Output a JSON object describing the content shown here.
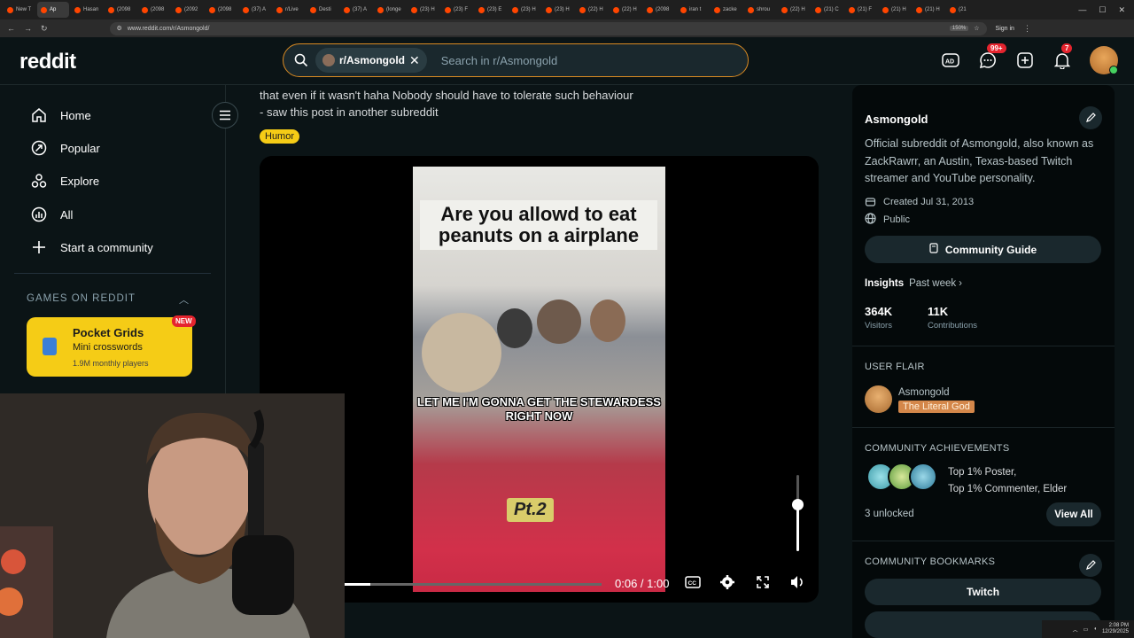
{
  "browser": {
    "tabs": [
      {
        "label": "New T"
      },
      {
        "label": "Ap",
        "active": true
      },
      {
        "label": "Hasan"
      },
      {
        "label": "(2098"
      },
      {
        "label": "(2098"
      },
      {
        "label": "(2092"
      },
      {
        "label": "(2098"
      },
      {
        "label": "(37) A"
      },
      {
        "label": "r/Live"
      },
      {
        "label": "Desti"
      },
      {
        "label": "(37) A"
      },
      {
        "label": "(longe"
      },
      {
        "label": "(23) H"
      },
      {
        "label": "(23) F"
      },
      {
        "label": "(23) E"
      },
      {
        "label": "(23) H"
      },
      {
        "label": "(23) H"
      },
      {
        "label": "(22) H"
      },
      {
        "label": "(22) H"
      },
      {
        "label": "(2098"
      },
      {
        "label": "iran t"
      },
      {
        "label": "zacke"
      },
      {
        "label": "shrou"
      },
      {
        "label": "(22) H"
      },
      {
        "label": "(21) C"
      },
      {
        "label": "(21) F"
      },
      {
        "label": "(21) H"
      },
      {
        "label": "(21) H"
      },
      {
        "label": "(21"
      }
    ],
    "url": "www.reddit.com/r/Asmongold/",
    "zoom": "150%",
    "sign_in": "Sign in"
  },
  "header": {
    "logo": "reddit",
    "search_chip": "r/Asmongold",
    "search_placeholder": "Search in r/Asmongold",
    "chat_badge": "99+",
    "notif_badge": "7"
  },
  "sidebar": {
    "items": [
      {
        "label": "Home",
        "icon": "home-icon"
      },
      {
        "label": "Popular",
        "icon": "popular-icon"
      },
      {
        "label": "Explore",
        "icon": "explore-icon"
      },
      {
        "label": "All",
        "icon": "all-icon"
      },
      {
        "label": "Start a community",
        "icon": "plus-icon"
      }
    ],
    "games_heading": "GAMES ON REDDIT",
    "game": {
      "title": "Pocket Grids",
      "subtitle": "Mini crosswords",
      "players": "1.9M monthly players",
      "badge": "NEW"
    }
  },
  "post": {
    "text_line1": "that even if it wasn't haha Nobody should have to tolerate such behaviour",
    "text_line2": "- saw this post in another subreddit",
    "flair": "Humor",
    "video": {
      "title_overlay": "Are you allowd to eat peanuts on a airplane",
      "caption": "LET ME I'M GONNA GET THE STEWARDESS RIGHT NOW",
      "part_label": "Pt.2",
      "time": "0:06 / 1:00",
      "progress": 0.1,
      "volume": 0.62
    }
  },
  "community": {
    "name": "Asmongold",
    "description": "Official subreddit of Asmongold, also known as ZackRawrr, an Austin, Texas-based Twitch streamer and YouTube personality.",
    "created": "Created Jul 31, 2013",
    "visibility": "Public",
    "guide_button": "Community Guide",
    "insights_label": "Insights",
    "insights_period": "Past week",
    "visitors_value": "364K",
    "visitors_label": "Visitors",
    "contributions_value": "11K",
    "contributions_label": "Contributions",
    "user_flair_heading": "USER FLAIR",
    "flair_user": "Asmongold",
    "flair_tag": "The Literal God",
    "achievements_heading": "COMMUNITY ACHIEVEMENTS",
    "achievement_line1": "Top 1% Poster,",
    "achievement_line2": "Top 1% Commenter, Elder",
    "unlocked": "3 unlocked",
    "view_all": "View All",
    "bookmarks_heading": "COMMUNITY BOOKMARKS",
    "bookmark_1": "Twitch"
  },
  "tray": {
    "time": "2:08 PM",
    "date": "12/29/2025"
  },
  "colors": {
    "accent_orange": "#d98a22",
    "flair_yellow": "#f5cc16",
    "badge_red": "#e5242e",
    "background": "#0b1416"
  }
}
